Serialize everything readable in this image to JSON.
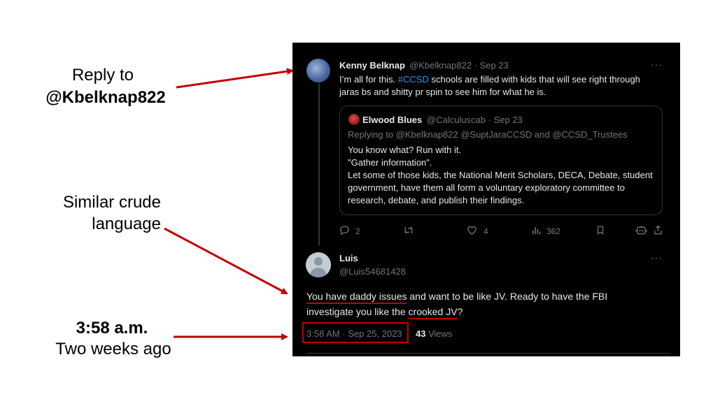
{
  "annotations": {
    "reply_line1": "Reply to",
    "reply_line2": "@Kbelknap822",
    "crude_line1": "Similar crude",
    "crude_line2": "language",
    "time_line1": "3:58 a.m.",
    "time_line2": "Two weeks ago",
    "arrow_color": "#c00000"
  },
  "tweet1": {
    "author": "Kenny Belknap",
    "handle_date": "@Kbelknap822 · Sep 23",
    "text_before": "I’m all for this. ",
    "hashtag": "#CCSD",
    "text_after": " schools are filled with kids that will see right through jaras bs and shitty pr spin to see him for what he is.",
    "more": "···",
    "quote": {
      "author": "Elwood Blues",
      "handle_date": "@Calculuscab · Sep 23",
      "replying_to": "Replying to @Kbelknap822 @SuptJaraCCSD and @CCSD_Trustees",
      "line1": "You know what? Run with it.",
      "line2": "\"Gather information\".",
      "line3": "Let some of those kids,  the National Merit Scholars, DECA, Debate, student government, have them all form a voluntary exploratory committee to research, debate, and publish their findings."
    },
    "actions": {
      "reply_icon": "reply-icon",
      "reply_count": "2",
      "retweet_icon": "retweet-icon",
      "like_icon": "heart-icon",
      "like_count": "4",
      "views_icon": "analytics-icon",
      "views_count": "362",
      "bookmark_icon": "bookmark-icon",
      "grok_icon": "robot-icon",
      "share_icon": "share-icon"
    }
  },
  "tweet2": {
    "author": "Luis",
    "handle": "@Luis54681428",
    "more": "···",
    "text_part1": "You have daddy issues",
    "text_part2": " and want to be like JV. Ready to have the FBI investigate you like the ",
    "text_part3": "crooked JV",
    "text_part4": "?",
    "timestamp": "3:58 AM · Sep 25, 2023",
    "views_count": "43",
    "views_label": "Views",
    "highlight_color": "#c00000"
  }
}
